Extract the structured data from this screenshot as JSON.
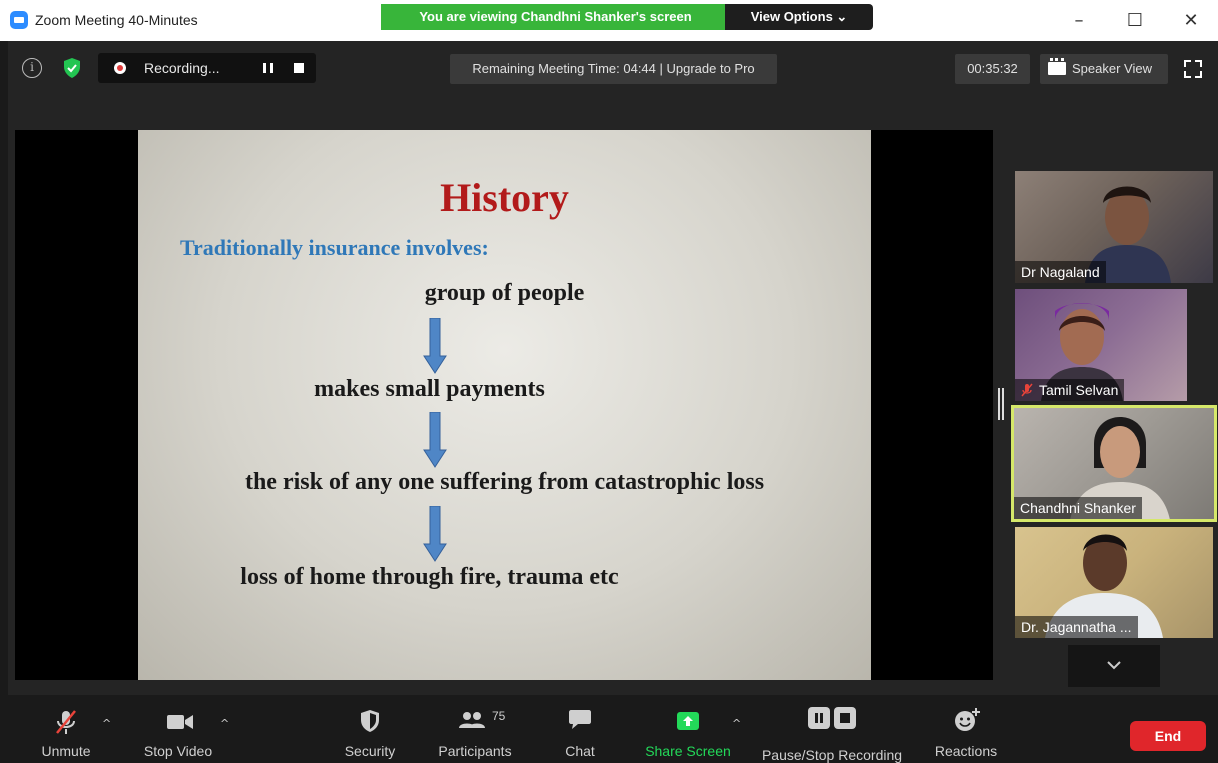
{
  "window": {
    "title": "Zoom Meeting 40-Minutes",
    "viewing_banner": "You are viewing Chandhni Shanker's screen",
    "view_options": "View Options ⌄",
    "minimize": "–",
    "maximize": "☐",
    "close": "✕"
  },
  "meeting_bar": {
    "recording_label": "Recording...",
    "remaining_time": "Remaining Meeting Time: 04:44 | Upgrade to Pro",
    "elapsed_time": "00:35:32",
    "speaker_view": "Speaker View",
    "info_glyph": "i"
  },
  "slide": {
    "title": "History",
    "subtitle": "Traditionally insurance involves:",
    "steps": [
      "group of people",
      "makes small payments",
      "the risk of any one suffering from catastrophic loss",
      "loss of home through fire, trauma etc"
    ]
  },
  "participants": [
    {
      "name": "Dr Nagaland",
      "muted": false,
      "active": false
    },
    {
      "name": "Tamil Selvan",
      "muted": true,
      "active": false
    },
    {
      "name": "Chandhni Shanker",
      "muted": false,
      "active": true
    },
    {
      "name": "Dr. Jagannatha ...",
      "muted": false,
      "active": false
    }
  ],
  "toolbar": {
    "unmute": "Unmute",
    "stop_video": "Stop Video",
    "security": "Security",
    "participants": "Participants",
    "participants_count": "75",
    "chat": "Chat",
    "share_screen": "Share Screen",
    "pause_stop_recording": "Pause/Stop Recording",
    "reactions": "Reactions",
    "end": "End",
    "caret": "^"
  },
  "colors": {
    "banner_green": "#38b53a",
    "share_green": "#23d959",
    "end_red": "#e0262b",
    "active_speaker_border": "#d6e86a",
    "slide_title_red": "#b21a1a",
    "slide_sub_blue": "#2f78b8",
    "arrow_blue": "#4f86c6"
  }
}
